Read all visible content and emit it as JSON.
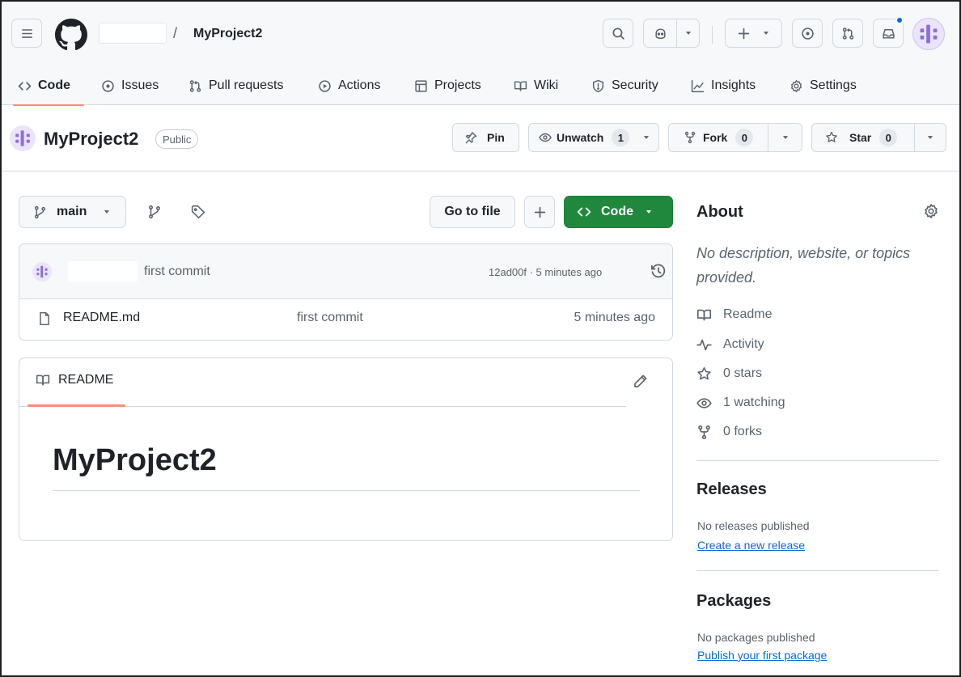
{
  "header": {
    "repo_name": "MyProject2",
    "separator": "/"
  },
  "tabs": [
    {
      "label": "Code"
    },
    {
      "label": "Issues"
    },
    {
      "label": "Pull requests"
    },
    {
      "label": "Actions"
    },
    {
      "label": "Projects"
    },
    {
      "label": "Wiki"
    },
    {
      "label": "Security"
    },
    {
      "label": "Insights"
    },
    {
      "label": "Settings"
    }
  ],
  "repo": {
    "name": "MyProject2",
    "visibility": "Public",
    "pin_label": "Pin",
    "unwatch_label": "Unwatch",
    "watch_count": "1",
    "fork_label": "Fork",
    "fork_count": "0",
    "star_label": "Star",
    "star_count": "0"
  },
  "toolbar": {
    "branch": "main",
    "go_to_file": "Go to file",
    "code_label": "Code"
  },
  "latest_commit": {
    "message": "first commit",
    "meta": "12ad00f · 5 minutes ago"
  },
  "files": [
    {
      "name": "README.md",
      "commit": "first commit",
      "age": "5 minutes ago"
    }
  ],
  "readme": {
    "tab_label": "README",
    "heading": "MyProject2"
  },
  "about": {
    "heading": "About",
    "description": "No description, website, or topics provided.",
    "items": [
      "Readme",
      "Activity",
      "0 stars",
      "1 watching",
      "0 forks"
    ]
  },
  "releases": {
    "heading": "Releases",
    "empty_text": "No releases published",
    "link": "Create a new release"
  },
  "packages": {
    "heading": "Packages",
    "empty_text": "No packages published",
    "link": "Publish your first package"
  },
  "colors": {
    "accent_green": "#1f883d",
    "link_blue": "#0969da",
    "tab_underline": "#fd8c73",
    "avatar_purple": "#8b6fd9"
  }
}
